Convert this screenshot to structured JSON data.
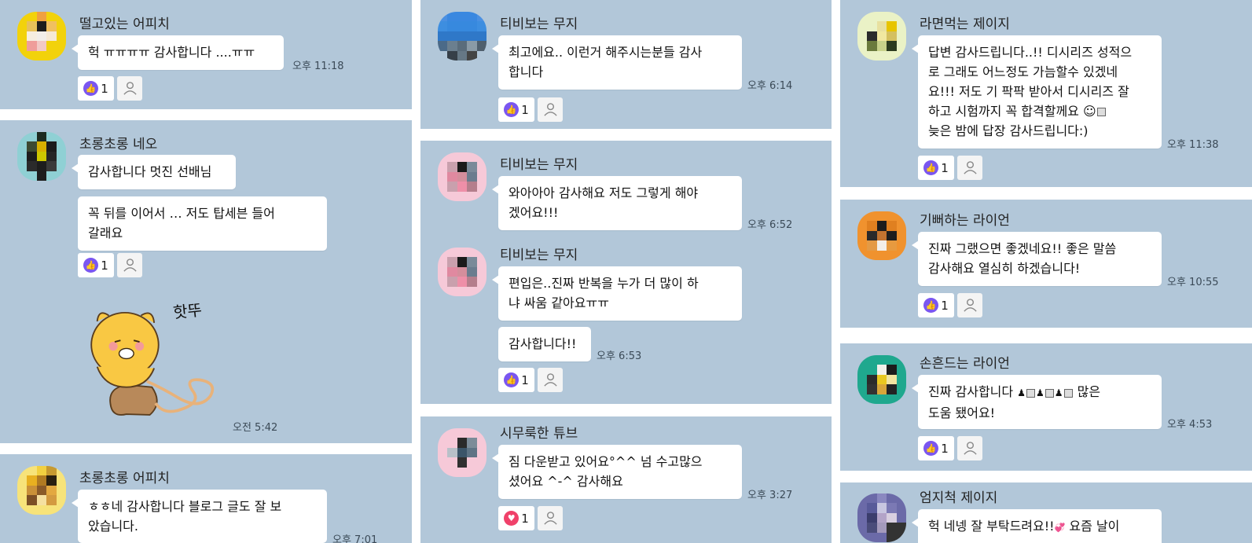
{
  "col1": {
    "msg1": {
      "name": "떨고있는 어피치",
      "text": "헉 ㅠㅠㅠㅠ 감사합니다 ....ㅠㅠ",
      "time": "오후 11:18",
      "likes": "1",
      "like_icon": "thumbs-up-icon",
      "accent": "#7a56f0"
    },
    "msg2": {
      "name": "초롱초롱 네오",
      "text1": "감사합니다 멋진 선배님",
      "text2_line1": "꼭 뒤를 이어서 … 저도 탑세븐 들어",
      "text2_line2": "갈래요",
      "likes": "1",
      "sticker_text": "핫뚜",
      "sticker_time": "오전 5:42"
    },
    "msg3": {
      "name": "초롱초롱 어피치",
      "line1": "ㅎㅎ네 감사합니다 블로그 글도 잘 보",
      "line2": "았습니다.",
      "time": "오후 7:01"
    }
  },
  "col2": {
    "msg1": {
      "name": "티비보는 무지",
      "line1": "최고에요.. 이런거 해주시는분들 감사",
      "line2": "합니다",
      "time": "오후 6:14",
      "likes": "1"
    },
    "msg2": {
      "name": "티비보는 무지",
      "line1": "와아아아 감사해요 저도 그렇게 해야",
      "line2": "겠어요!!!",
      "time": "오후 6:52"
    },
    "msg3": {
      "name": "티비보는 무지",
      "line1": "편입은..진짜 반복을 누가 더 많이 하",
      "line2": "냐 싸움 같아요ㅠㅠ",
      "text2": "감사합니다!!",
      "time": "오후 6:53",
      "likes": "1"
    },
    "msg4": {
      "name": "시무룩한 튜브",
      "line1": "짐 다운받고 있어요°^^  넘 수고많으",
      "line2": "셨어요 ^-^  감사해요",
      "time": "오후 3:27",
      "likes": "1",
      "like_icon": "heart-icon",
      "heart_color": "#f0416a"
    }
  },
  "col3": {
    "msg1": {
      "name": "라면먹는 제이지",
      "line1": "답변 감사드립니다..!! 디시리즈 성적으",
      "line2": "로 그래도 어느정도 가늠할수 있겠네",
      "line3": "요!!! 저도 기 팍팍 받아서 디시리즈 잘",
      "line4": " 하고 시험까지 꼭 합격할께요",
      "line5": "늦은 밤에 답장 감사드립니다:)",
      "time": "오후 11:38",
      "likes": "1"
    },
    "msg2": {
      "name": "기뻐하는 라이언",
      "line1": "진짜 그랬으면 좋겠네요!! 좋은 말씀",
      "line2": "감사해요 열심히 하겠습니다!",
      "time": "오후 10:55",
      "likes": "1"
    },
    "msg3": {
      "name": "손흔드는 라이언",
      "line1": "진짜 감사합니다",
      "line1_end": "많은",
      "line2": "도움 됐어요!",
      "time": "오후 4:53",
      "likes": "1"
    },
    "msg4": {
      "name": "엄지척 제이지",
      "line1": "헉 네넹 잘 부탁드려요!!",
      "line1_end": "요즘 날이"
    }
  }
}
